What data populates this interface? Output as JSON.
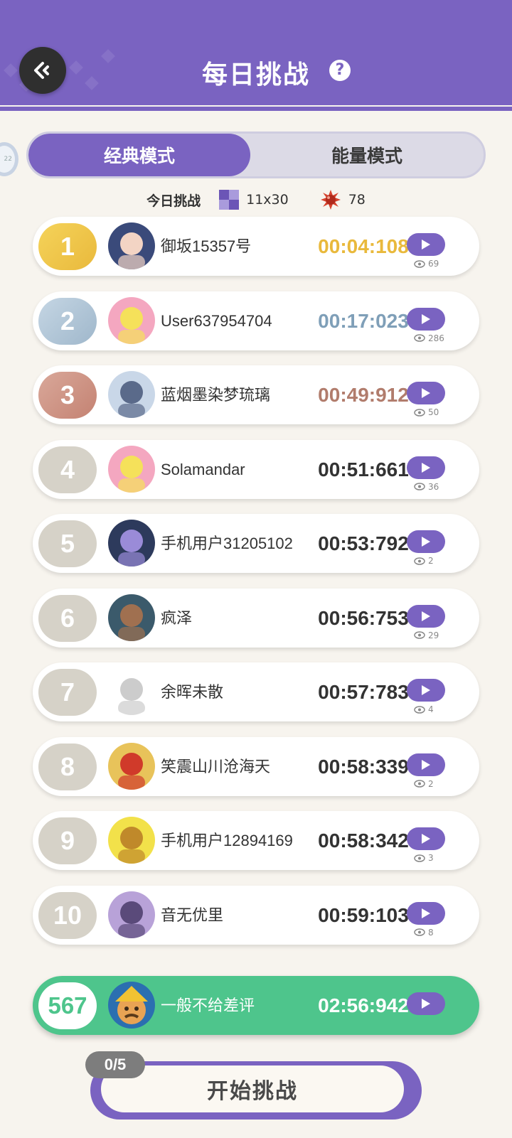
{
  "header": {
    "title": "每日挑战",
    "help_icon": "question-circle-icon",
    "back_icon": "back-arrow-icon"
  },
  "tabs": [
    {
      "label": "经典模式",
      "active": true
    },
    {
      "label": "能量模式",
      "active": false
    }
  ],
  "challenge_info": {
    "label": "今日挑战",
    "grid_size": "11x30",
    "mine_count": "78"
  },
  "leaderboard": [
    {
      "rank": "1",
      "name": "御坂15357号",
      "time": "00:04:108",
      "views": "69"
    },
    {
      "rank": "2",
      "name": "User637954704",
      "time": "00:17:023",
      "views": "286"
    },
    {
      "rank": "3",
      "name": "蓝烟墨染梦琉璃",
      "time": "00:49:912",
      "views": "50"
    },
    {
      "rank": "4",
      "name": "Solamandar",
      "time": "00:51:661",
      "views": "36"
    },
    {
      "rank": "5",
      "name": "手机用户31205102",
      "time": "00:53:792",
      "views": "2"
    },
    {
      "rank": "6",
      "name": "疯泽",
      "time": "00:56:753",
      "views": "29"
    },
    {
      "rank": "7",
      "name": "余晖未散",
      "time": "00:57:783",
      "views": "4"
    },
    {
      "rank": "8",
      "name": "笑震山川沧海天",
      "time": "00:58:339",
      "views": "2"
    },
    {
      "rank": "9",
      "name": "手机用户12894169",
      "time": "00:58:342",
      "views": "3"
    },
    {
      "rank": "10",
      "name": "音无优里",
      "time": "00:59:103",
      "views": "8"
    }
  ],
  "self_entry": {
    "rank": "567",
    "name": "一般不给差评",
    "time": "02:56:942"
  },
  "start": {
    "label": "开始挑战",
    "attempts": "0/5"
  },
  "colors": {
    "primary": "#7a63c1",
    "gold": "#e9b93c",
    "silver": "#7f9fb8",
    "bronze": "#b17c6c",
    "self_green": "#4ec58c",
    "default_rank": "#d6d2c8"
  }
}
